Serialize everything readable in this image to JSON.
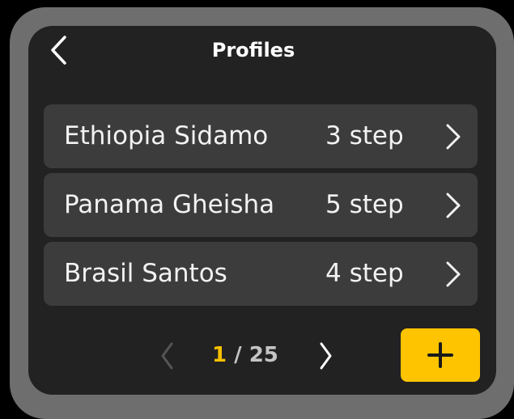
{
  "header": {
    "title": "Profiles",
    "back_icon": "chevron-left-icon"
  },
  "profiles": [
    {
      "name": "Ethiopia Sidamo",
      "steps": "3 step"
    },
    {
      "name": "Panama Gheisha",
      "steps": "5 step"
    },
    {
      "name": "Brasil Santos",
      "steps": "4 step"
    }
  ],
  "pagination": {
    "current": "1",
    "separator": "/",
    "total": "25",
    "prev_icon": "chevron-left-icon",
    "next_icon": "chevron-right-icon"
  },
  "add_button": {
    "icon": "plus-icon"
  },
  "colors": {
    "accent": "#ffc400",
    "screen_bg": "#222222",
    "row_bg": "#3c3c3c",
    "bezel": "#6e6e6e",
    "page_current": "#f5c000",
    "text": "#f2f2f2",
    "disabled": "#555555"
  }
}
